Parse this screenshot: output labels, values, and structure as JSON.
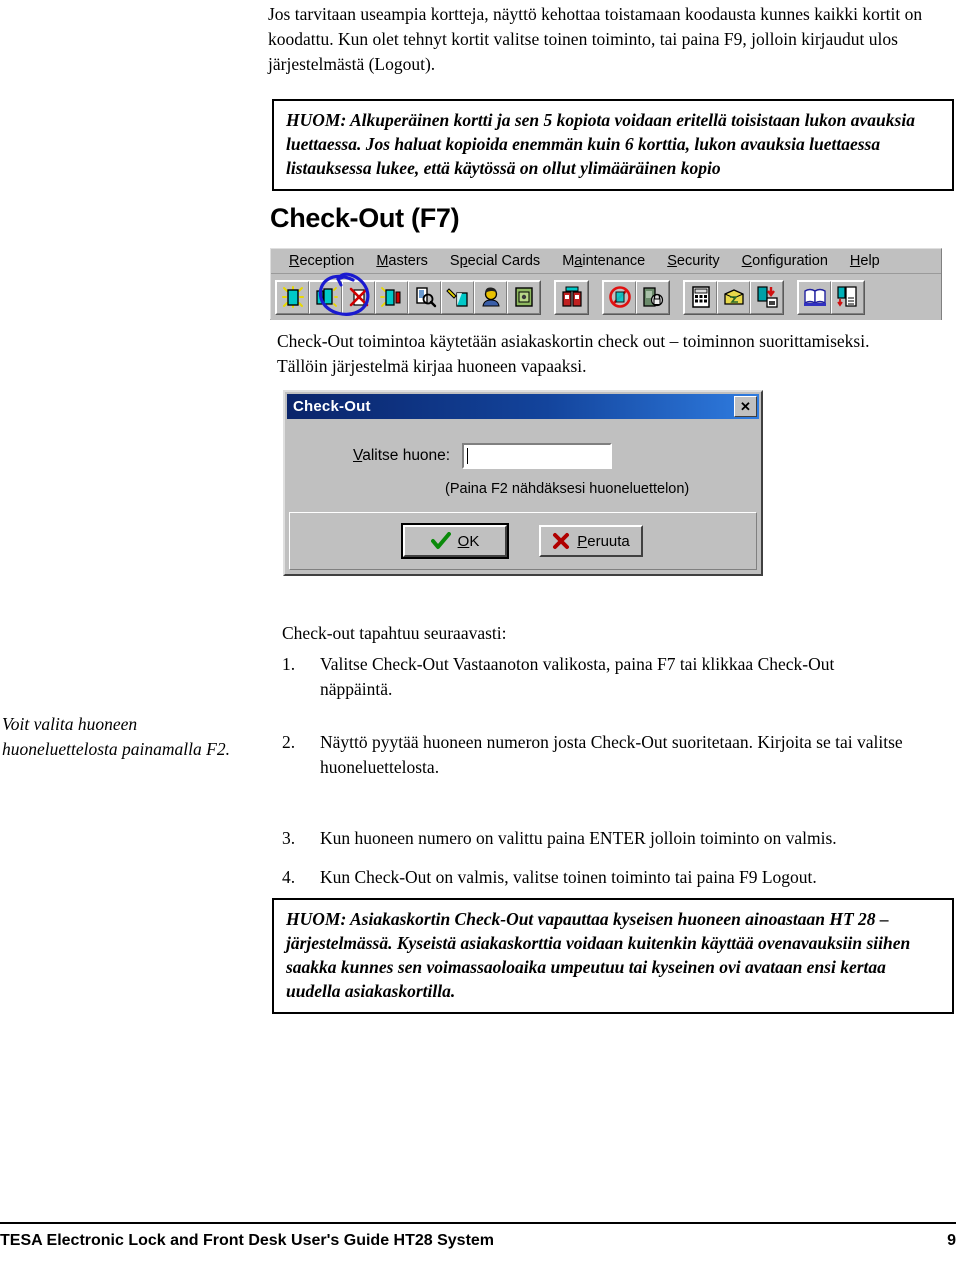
{
  "intro_paragraph": "Jos tarvitaan useampia kortteja, näyttö kehottaa toistamaan koodausta kunnes kaikki kortit on koodattu. Kun olet tehnyt kortit valitse toinen toiminto, tai paina F9, jolloin kirjaudut ulos järjestelmästä (Logout).",
  "note_top": "HUOM: Alkuperäinen kortti ja sen 5 kopiota voidaan eritellä toisistaan lukon avauksia luettaessa. Jos haluat kopioida enemmän kuin 6 korttia, lukon avauksia luettaessa listauksessa lukee, että käytössä on ollut ylimääräinen kopio",
  "note_bottom": "HUOM: Asiakaskortin Check-Out vapauttaa kyseisen huoneen ainoastaan HT 28 – järjestelmässä. Kyseistä asiakaskorttia voidaan kuitenkin käyttää ovenavauksiin siihen saakka kunnes sen voimassaoloaika umpeutuu  tai kyseinen ovi avataan ensi kertaa uudella asiakaskortilla.",
  "section_heading": "Check-Out (F7)",
  "app_window": {
    "menu": [
      {
        "accel": "R",
        "rest": "eception"
      },
      {
        "accel": "M",
        "rest": "asters"
      },
      {
        "pre": "S",
        "accel": "p",
        "rest": "ecial Cards"
      },
      {
        "pre": "M",
        "accel": "a",
        "rest": "intenance"
      },
      {
        "accel": "S",
        "rest": "ecurity"
      },
      {
        "accel": "C",
        "rest": "onfiguration"
      },
      {
        "accel": "H",
        "rest": "elp"
      }
    ],
    "toolbar_groups": [
      {
        "buttons": [
          "check-in-icon",
          "copy-card-icon",
          "check-out-icon",
          "room-change-icon",
          "card-read-icon",
          "cancel-card-icon",
          "guest-icon",
          "safe-icon"
        ]
      },
      {
        "buttons": [
          "emergency-icon"
        ]
      },
      {
        "buttons": [
          "lockout-icon",
          "privacy-lock-icon"
        ]
      },
      {
        "buttons": [
          "calculator-icon",
          "package-icon",
          "save-card-icon"
        ]
      },
      {
        "buttons": [
          "audit-book-icon",
          "report-print-icon"
        ]
      }
    ],
    "annotation_color": "#1a1ad0",
    "annotation_target": "check-out-icon"
  },
  "toolbar_description": "Check-Out toimintoa käytetään asiakaskortin check out – toiminnon suorittamiseksi. Tällöin järjestelmä kirjaa huoneen vapaaksi.",
  "dialog": {
    "title": "Check-Out",
    "close_label": "✕",
    "field_label_accel": "V",
    "field_label_rest": "alitse huone:",
    "field_value": "",
    "field_placeholder": "",
    "hint": "(Paina F2 nähdäksesi huoneluettelon)",
    "ok_label_accel": "O",
    "ok_label_rest": "K",
    "cancel_label_accel": "P",
    "cancel_label_rest": "eruuta",
    "titlebar_color_start": "#0a246a",
    "titlebar_color_end": "#2f7ce0"
  },
  "procedure_intro": "Check-out tapahtuu seuraavasti:",
  "margin_note": "Voit valita huoneen huoneluettelosta painamalla F2.",
  "procedure_steps": [
    {
      "num": "1.",
      "text": "Valitse Check-Out Vastaanoton valikosta, paina F7 tai klikkaa Check-Out näppäintä."
    },
    {
      "num": "2.",
      "text": "Näyttö pyytää huoneen numeron josta Check-Out suoritetaan. Kirjoita se tai valitse huoneluettelosta."
    },
    {
      "num": "3.",
      "text": "Kun huoneen numero on valittu paina ENTER jolloin toiminto on valmis."
    },
    {
      "num": "4.",
      "text": "Kun Check-Out on valmis, valitse toinen toiminto tai paina F9 Logout."
    }
  ],
  "footer": {
    "title": "TESA Electronic Lock and Front Desk User's Guide HT28 System",
    "page_number": "9"
  }
}
